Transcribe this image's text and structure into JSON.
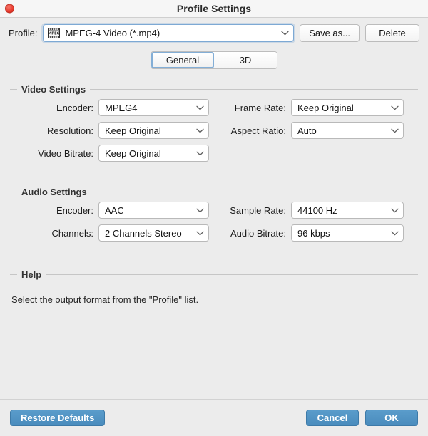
{
  "window": {
    "title": "Profile Settings",
    "close_label": ""
  },
  "profile_row": {
    "label": "Profile:",
    "icon": "mpeg-film-icon",
    "value": "MPEG-4 Video (*.mp4)",
    "save_as_label": "Save as...",
    "delete_label": "Delete"
  },
  "tabs": [
    {
      "label": "General",
      "selected": true
    },
    {
      "label": "3D",
      "selected": false
    }
  ],
  "video_settings": {
    "title": "Video Settings",
    "fields": [
      {
        "label": "Encoder:",
        "value": "MPEG4"
      },
      {
        "label": "Frame Rate:",
        "value": "Keep Original"
      },
      {
        "label": "Resolution:",
        "value": "Keep Original"
      },
      {
        "label": "Aspect Ratio:",
        "value": "Auto"
      },
      {
        "label": "Video Bitrate:",
        "value": "Keep Original"
      }
    ]
  },
  "audio_settings": {
    "title": "Audio Settings",
    "fields": [
      {
        "label": "Encoder:",
        "value": "AAC"
      },
      {
        "label": "Sample Rate:",
        "value": "44100 Hz"
      },
      {
        "label": "Channels:",
        "value": "2 Channels Stereo"
      },
      {
        "label": "Audio Bitrate:",
        "value": "96 kbps"
      }
    ]
  },
  "help": {
    "title": "Help",
    "text": "Select the output format from the \"Profile\" list."
  },
  "footer": {
    "restore_defaults_label": "Restore Defaults",
    "cancel_label": "Cancel",
    "ok_label": "OK"
  },
  "colors": {
    "accent_blue": "#4a8cbd",
    "focus_blue": "#7da9d4",
    "window_bg": "#ececec",
    "titlebar_bg": "#f6f6f6",
    "close_red": "#e8392c",
    "field_bg": "#ffffff",
    "border_gray": "#b9b9b9"
  }
}
